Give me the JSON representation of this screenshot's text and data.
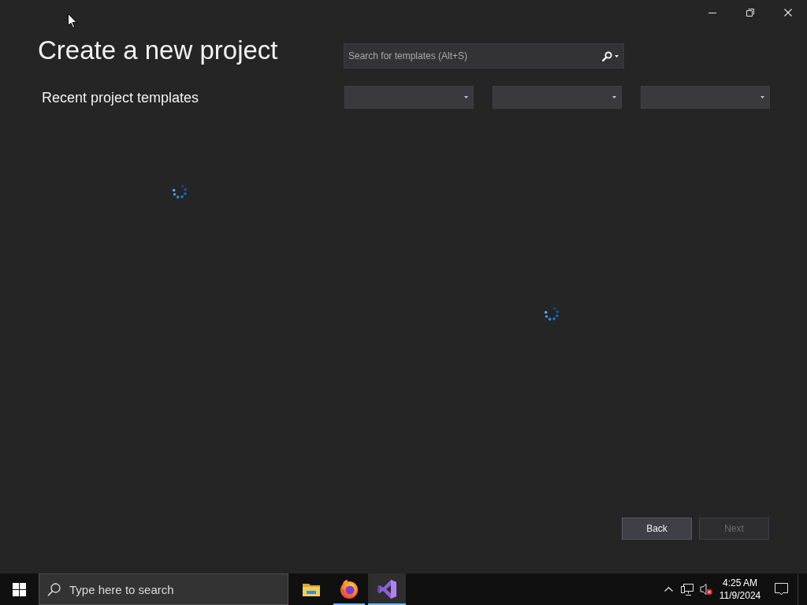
{
  "window": {
    "title": "Create a new project"
  },
  "search": {
    "placeholder": "Search for templates (Alt+S)"
  },
  "recent": {
    "title": "Recent project templates",
    "loading": true
  },
  "filters": [
    {
      "kind": "dropdown"
    },
    {
      "kind": "dropdown"
    },
    {
      "kind": "dropdown"
    }
  ],
  "templates": {
    "loading": true
  },
  "buttons": [
    {
      "label": "Back",
      "disabled": false
    },
    {
      "label": "Next",
      "disabled": true
    }
  ],
  "taskbar": {
    "search": {
      "placeholder": "Type here to search"
    },
    "apps": [
      {
        "kind": "folder",
        "running": false,
        "selected": false
      },
      {
        "kind": "browser",
        "running": true,
        "selected": false
      },
      {
        "kind": "ide",
        "running": true,
        "selected": true
      }
    ],
    "tray": {
      "muted": true
    },
    "clock": {
      "time": "4:25 AM",
      "date": "11/9/2024"
    }
  }
}
